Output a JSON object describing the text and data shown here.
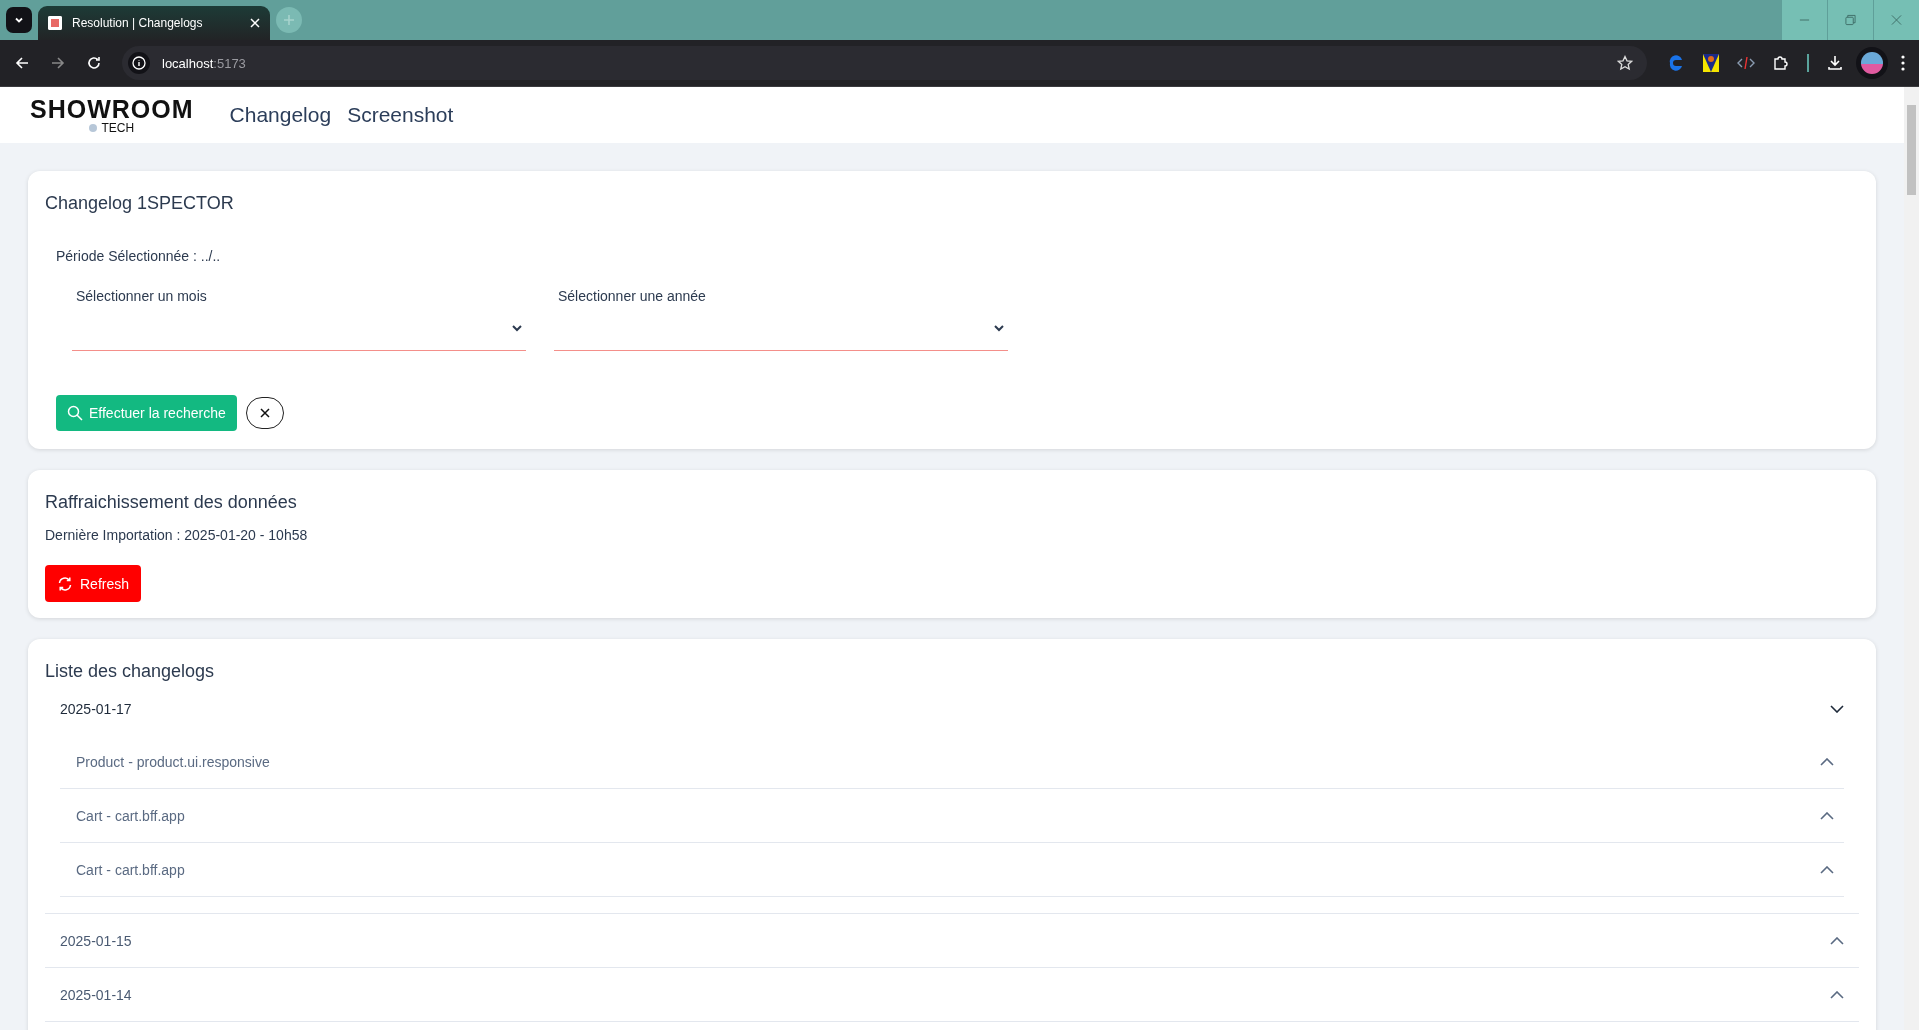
{
  "browser": {
    "tab_title": "Resolution | Changelogs",
    "url_host": "localhost",
    "url_port": ":5173"
  },
  "header": {
    "logo_main": "SHOWROOM",
    "logo_sub": "TECH",
    "nav": [
      {
        "label": "Changelog"
      },
      {
        "label": "Screenshot"
      }
    ]
  },
  "search_card": {
    "title": "Changelog 1SPECTOR",
    "period": "Période Sélectionnée : ../..",
    "selects": [
      {
        "label": "Sélectionner un mois"
      },
      {
        "label": "Sélectionner une année"
      }
    ],
    "search_button": "Effectuer la recherche"
  },
  "refresh_card": {
    "title": "Raffraichissement des données",
    "last_import": "Dernière Importation : 2025-01-20 - 10h58",
    "refresh_button": "Refresh"
  },
  "list_card": {
    "title": "Liste des changelogs",
    "groups": [
      {
        "date": "2025-01-17",
        "expanded": true,
        "children": [
          {
            "label": "Product - product.ui.responsive",
            "expanded": false
          },
          {
            "label": "Cart - cart.bff.app",
            "expanded": false
          },
          {
            "label": "Cart - cart.bff.app",
            "expanded": false
          }
        ]
      },
      {
        "date": "2025-01-15",
        "expanded": false
      },
      {
        "date": "2025-01-14",
        "expanded": false
      }
    ]
  }
}
